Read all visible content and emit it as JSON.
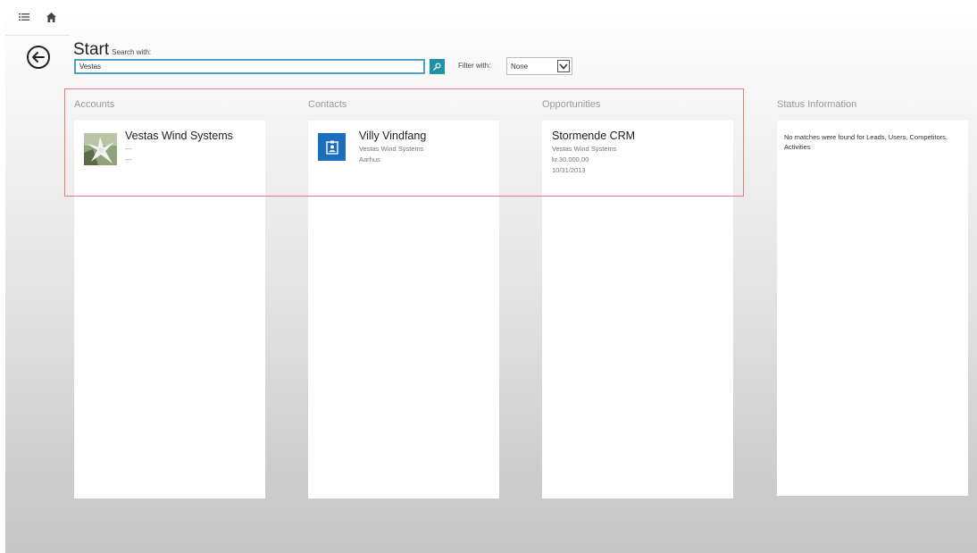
{
  "header": {
    "title": "Start",
    "search_caption": "Search with:",
    "search_value": "Vestas",
    "filter_label": "Filter with:",
    "filter_value": "None"
  },
  "icons": {
    "menu": "menu-icon",
    "home": "home-icon",
    "back": "back-arrow-icon",
    "search": "search-icon",
    "chevron": "chevron-down-icon",
    "contact": "contact-card-icon"
  },
  "colors": {
    "accent": "#1f93a6",
    "contact_tile": "#1b6ebd",
    "highlight": "#e47b7b"
  },
  "columns": {
    "accounts": {
      "title": "Accounts",
      "items": [
        {
          "name": "Vestas Wind Systems",
          "line1": "---",
          "line2": "---"
        }
      ]
    },
    "contacts": {
      "title": "Contacts",
      "items": [
        {
          "name": "Villy Vindfang",
          "line1": "Vestas Wind Systems",
          "line2": "Aarhus"
        }
      ]
    },
    "opportunities": {
      "title": "Opportunities",
      "items": [
        {
          "name": "Stormende CRM",
          "line1": "Vestas Wind Systems",
          "line2": "kr.30.000,00",
          "line3": "10/31/2013"
        }
      ]
    },
    "status": {
      "title": "Status Information",
      "message": "No matches were found for Leads, Users, Competitors, Activities"
    }
  }
}
